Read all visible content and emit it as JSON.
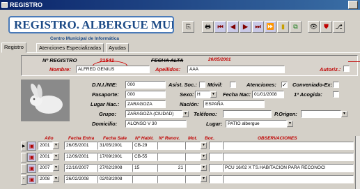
{
  "window": {
    "title": "REGISTRO"
  },
  "header": {
    "app_title": "REGISTRO. ALBERGUE MUNICIPAL",
    "subtitle": "Centro Municipal de Informática"
  },
  "toolbar": [
    "⎘",
    "🖶",
    "⏮",
    "◀",
    "▶",
    "⏭",
    "⏩",
    "▮",
    "⧉",
    "👁",
    "⛊",
    "⎇"
  ],
  "tabs": [
    "Registro",
    "Atenciones Especializadas",
    "Ayudas"
  ],
  "registro": {
    "num_label": "Nº REGISTRO",
    "num_value": "21541",
    "fecha_alta_label": "FECHA ALTA",
    "fecha_alta_value": "26/05/2001",
    "nombre_label": "Nombre:",
    "nombre_value": "ALFRED GENIUS",
    "apellidos_label": "Apellidos:",
    "apellidos_value": "AAA",
    "autoriz_label": "Autoriz.:"
  },
  "details": {
    "dni_label": "D.N.I./NIE:",
    "dni_value": "000",
    "asist_label": "Asist. Soc.:",
    "movil_label": "Móvil:",
    "movil_checked": "",
    "atenciones_label": "Atenciones:",
    "atenciones_checked": "✓",
    "conveniado_label": "Conveniado-Ex:",
    "pasaporte_label": "Pasaporte:",
    "pasaporte_value": "000",
    "sexo_label": "Sexo:",
    "sexo_value": "H",
    "fecha_nac_label": "Fecha Nac:",
    "fecha_nac_value": "01/01/2008",
    "acogida_label": "1ª Acogida:",
    "lugar_nac_label": "Lugar Nac.:",
    "lugar_nac_value": "ZARAGOZA",
    "nacion_label": "Nación:",
    "nacion_value": "ESPAÑA",
    "grupo_label": "Grupo:",
    "grupo_value": "ZARAGOZA (CIUDAD)",
    "telefono_label": "Teléfono:",
    "origen_label": "P.Origen:",
    "domicilio_label": "Domicilio:",
    "domicilio_value": "ALONSO V 30",
    "lugar_label": "Lugar:",
    "lugar_value": "PATIO albergue"
  },
  "grid": {
    "headers": [
      "Año",
      "Fecha Entra",
      "Fecha Sale",
      "Nº Habit.",
      "Nº Renov.",
      "Mot.",
      "Boc.",
      "OBSERVACIONES"
    ],
    "rows": [
      {
        "sel": "▶",
        "year": "2001",
        "entra": "26/05/2001",
        "sale": "31/05/2001",
        "habit": "CB-29",
        "renov": "",
        "obs": ""
      },
      {
        "sel": "",
        "year": "2001",
        "entra": "12/09/2001",
        "sale": "17/09/2001",
        "habit": "CB-55",
        "renov": "",
        "obs": ""
      },
      {
        "sel": "",
        "year": "2007",
        "entra": "22/10/2007",
        "sale": "27/02/2008",
        "habit": "15",
        "renov": "21",
        "obs": "PCU 16/02 X TS.HABITACION PARA RECONOCI"
      },
      {
        "sel": "*",
        "year": "2008",
        "entra": "26/02/2008",
        "sale": "02/03/2008",
        "habit": "",
        "renov": "",
        "obs": ""
      }
    ]
  },
  "colors": {
    "title_bar": "#0a246a",
    "accent_blue": "#1c4a86",
    "label_red": "#c00000",
    "window_bg": "#d4d0c8"
  }
}
